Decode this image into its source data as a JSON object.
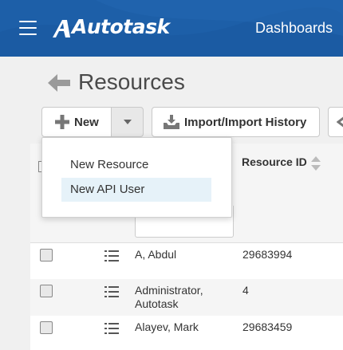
{
  "header": {
    "app_name": "Autotask",
    "nav_item": "Dashboards",
    "colors": {
      "bar": "#1d5fa8",
      "text": "#ffffff"
    }
  },
  "page": {
    "title": "Resources"
  },
  "toolbar": {
    "new_label": "New",
    "import_label": "Import/Import History"
  },
  "dropdown": {
    "items": [
      {
        "label": "New Resource"
      },
      {
        "label": "New API User",
        "highlighted": true
      }
    ]
  },
  "grid": {
    "columns": {
      "resource_id": "Resource ID"
    },
    "rows": [
      {
        "name": "A, Abdul",
        "resource_id": "29683994"
      },
      {
        "name": "Administrator, Autotask",
        "resource_id": "4"
      },
      {
        "name": "Alayev, Mark",
        "resource_id": "29683459"
      }
    ]
  },
  "icons": [
    "hamburger-icon",
    "back-arrow-icon",
    "plus-icon",
    "caret-down-icon",
    "import-icon",
    "sort-icon",
    "row-menu-icon"
  ]
}
